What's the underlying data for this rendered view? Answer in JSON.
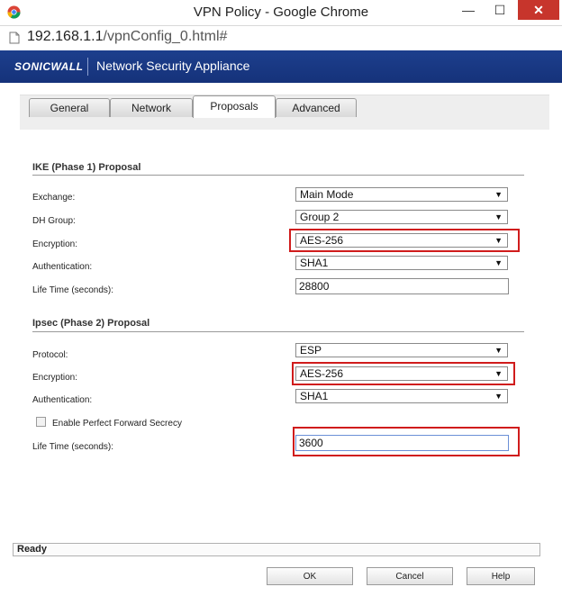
{
  "window": {
    "title": "VPN Policy - Google Chrome",
    "minimize_glyph": "—",
    "maximize_glyph": "☐",
    "close_glyph": "✕"
  },
  "address": {
    "host": "192.168.1.1",
    "path": "/vpnConfig_0.html#"
  },
  "header": {
    "logo": "SONICWALL",
    "product": "Network Security Appliance",
    "brand_color": "#1d3f8d"
  },
  "tabs": [
    {
      "label": "General"
    },
    {
      "label": "Network"
    },
    {
      "label": "Proposals",
      "active": true
    },
    {
      "label": "Advanced"
    }
  ],
  "ike": {
    "title": "IKE (Phase 1) Proposal",
    "exchange": {
      "label": "Exchange:",
      "value": "Main Mode"
    },
    "dh_group": {
      "label": "DH Group:",
      "value": "Group 2"
    },
    "encryption": {
      "label": "Encryption:",
      "value": "AES-256"
    },
    "authentication": {
      "label": "Authentication:",
      "value": "SHA1"
    },
    "lifetime": {
      "label": "Life Time (seconds):",
      "value": "28800"
    }
  },
  "ipsec": {
    "title": "Ipsec (Phase 2) Proposal",
    "protocol": {
      "label": "Protocol:",
      "value": "ESP"
    },
    "encryption": {
      "label": "Encryption:",
      "value": "AES-256"
    },
    "authentication": {
      "label": "Authentication:",
      "value": "SHA1"
    },
    "pfs": {
      "label": "Enable Perfect Forward Secrecy",
      "checked": false
    },
    "lifetime": {
      "label": "Life Time (seconds):",
      "value": "3600"
    }
  },
  "status": {
    "text": "Ready"
  },
  "buttons": {
    "ok": "OK",
    "cancel": "Cancel",
    "help": "Help"
  },
  "icons": {
    "dropdown": "▼"
  },
  "highlight_color": "#d01c1c"
}
